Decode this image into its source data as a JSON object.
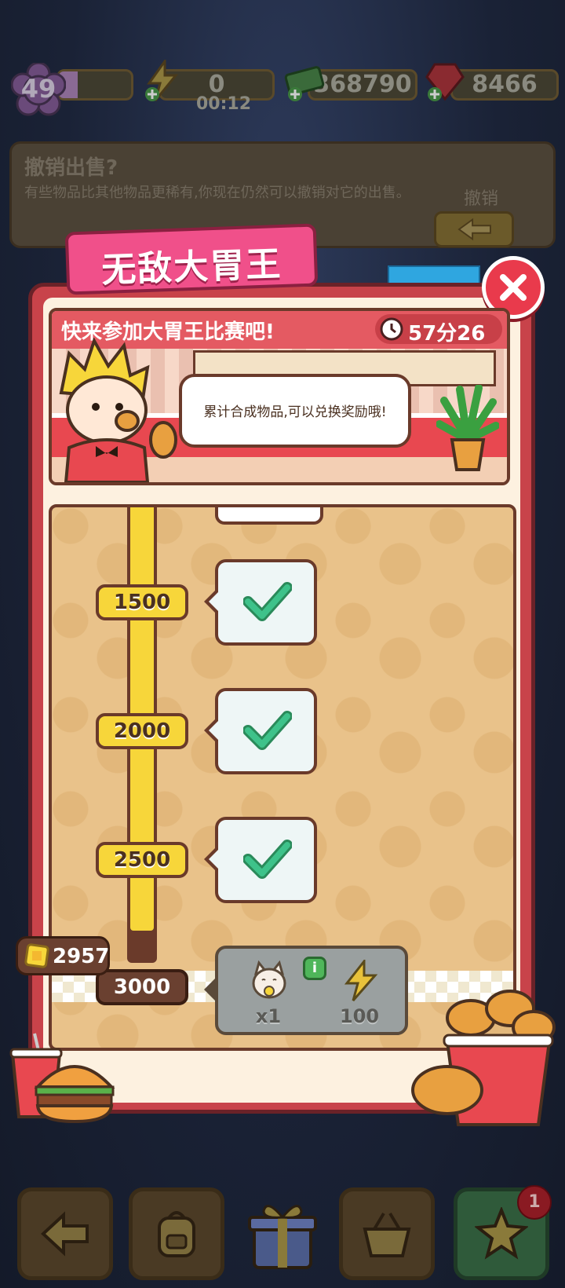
{
  "top_bar": {
    "level": "49",
    "energy": "0",
    "energy_timer": "00:12",
    "cash": "368790",
    "gems": "8466"
  },
  "undo_panel": {
    "title": "撤销出售?",
    "description": "有些物品比其他物品更稀有,你现在仍然可以撤销对它的出售。",
    "button_label": "撤销"
  },
  "event": {
    "tab_title": "无敌大胃王",
    "banner_title": "快来参加大胃王比赛吧!",
    "timer": "57分26秒",
    "speech": "累计合成物品,可以兑换奖励哦!",
    "current_points": "2957",
    "milestones": [
      {
        "points": "1500",
        "completed": true
      },
      {
        "points": "2000",
        "completed": true
      },
      {
        "points": "2500",
        "completed": true
      },
      {
        "points": "3000",
        "completed": false
      }
    ],
    "next_rewards": [
      {
        "icon": "lucky-cat-icon",
        "count": "x1"
      },
      {
        "icon": "lightning-energy-icon",
        "count": "100"
      }
    ],
    "progress_fraction": 0.93
  },
  "bottom_nav": {
    "notification_count": "1",
    "items": [
      "back-arrow-icon",
      "backpack-icon",
      "gift-box-icon",
      "basket-icon",
      "star-icon"
    ]
  },
  "colors": {
    "panel_red": "#c8434a",
    "tab_pink": "#f0508a",
    "progress_yellow": "#f7d63a",
    "check_green": "#3ec28a"
  }
}
